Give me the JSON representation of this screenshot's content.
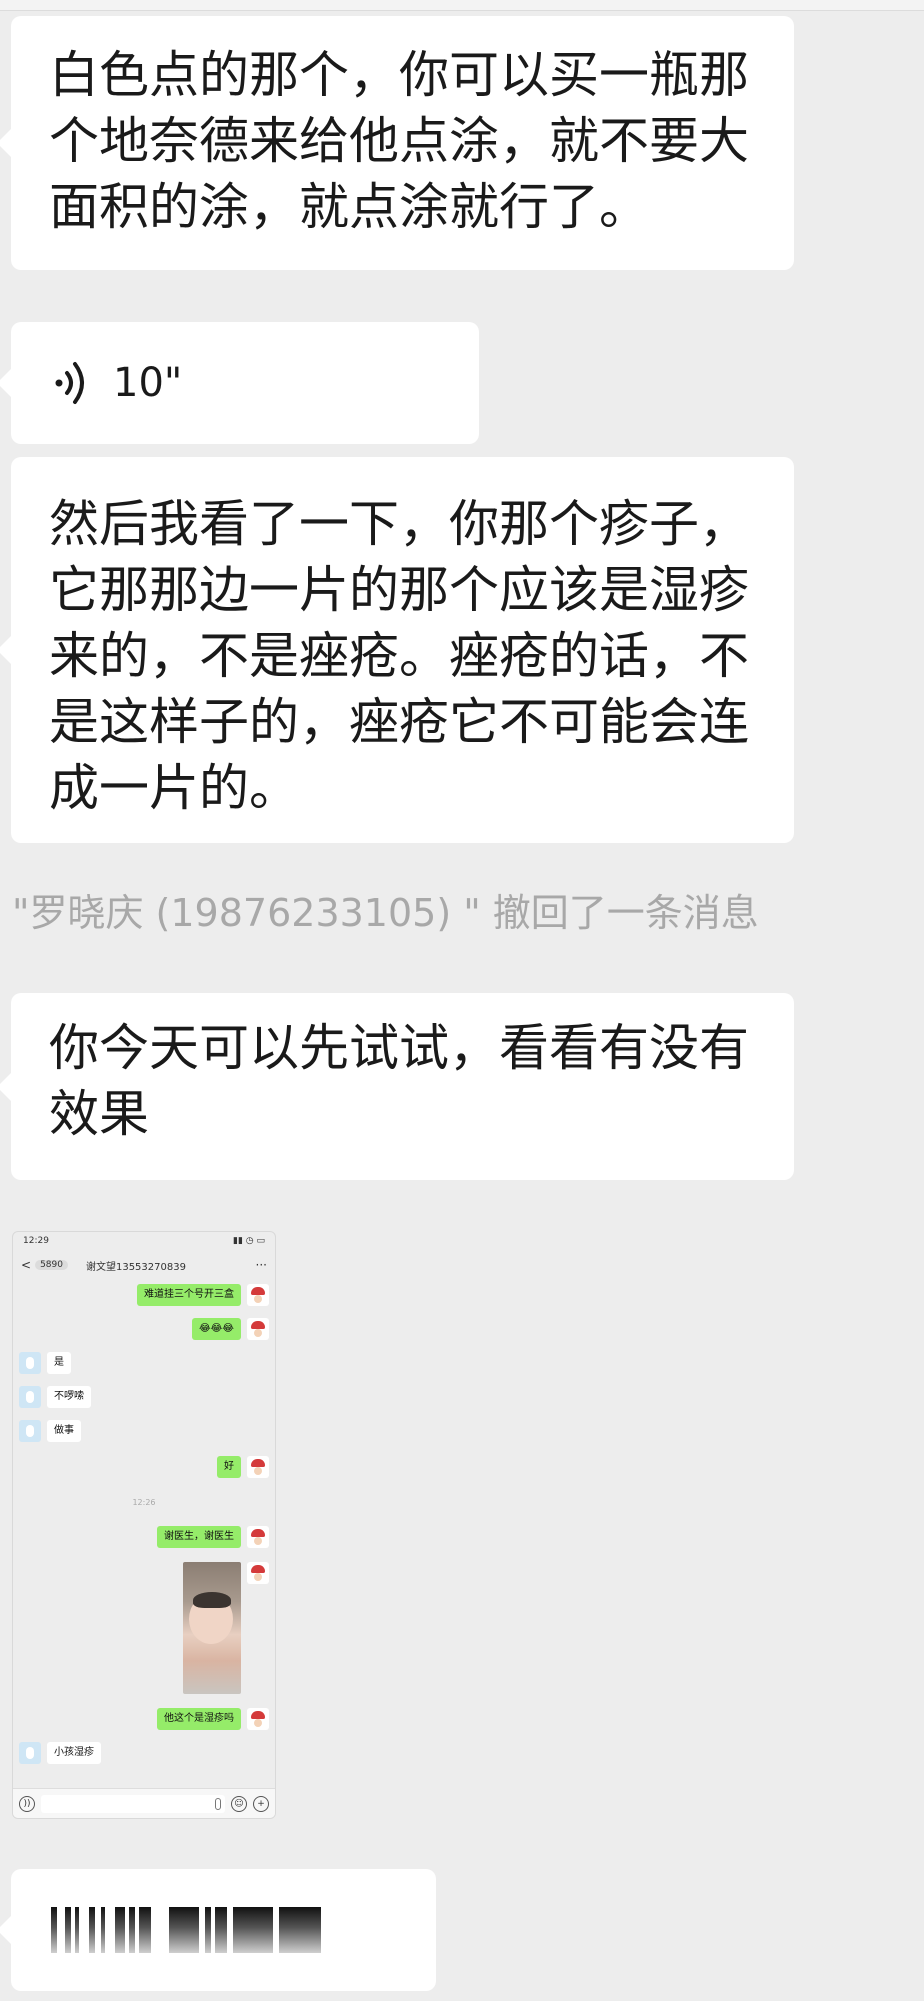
{
  "messages": {
    "m1": "白色点的那个，你可以买一瓶那个地奈德来给他点涂，就不要大面积的涂，就点涂就行了。",
    "voice_duration": "10\"",
    "m3": "然后我看了一下，你那个疹子，它那那边一片的那个应该是湿疹来的，不是痤疮。痤疮的话，不是这样子的，痤疮它不可能会连成一片的。",
    "recall_notice": "\"罗晓庆 (19876233105) \" 撤回了一条消息",
    "m4": "你今天可以先试试，看看有没有效果"
  },
  "screenshot": {
    "status_time": "12:29",
    "status_right": "▮▮ ◷ ▭",
    "back_icon": "<",
    "unread_count": "5890",
    "contact_name": "谢文望13553270839",
    "more_icon": "···",
    "bubbles": {
      "r1": "难道挂三个号开三盒",
      "r2": "😂😂😂",
      "l1": "是",
      "l2": "不啰嗦",
      "l3": "做事",
      "r3": "好",
      "time": "12:26",
      "r4": "谢医生，谢医生",
      "r5": "他这个是湿疹吗",
      "l4": "小孩湿疹"
    },
    "input_icons": [
      "voice-icon",
      "emoji-icon",
      "plus-icon"
    ]
  },
  "colors": {
    "background": "#ededed",
    "bubble_incoming": "#ffffff",
    "bubble_outgoing": "#95ec69",
    "notice_text": "#a8a8a8"
  },
  "last_message": "redacted-censored-text"
}
